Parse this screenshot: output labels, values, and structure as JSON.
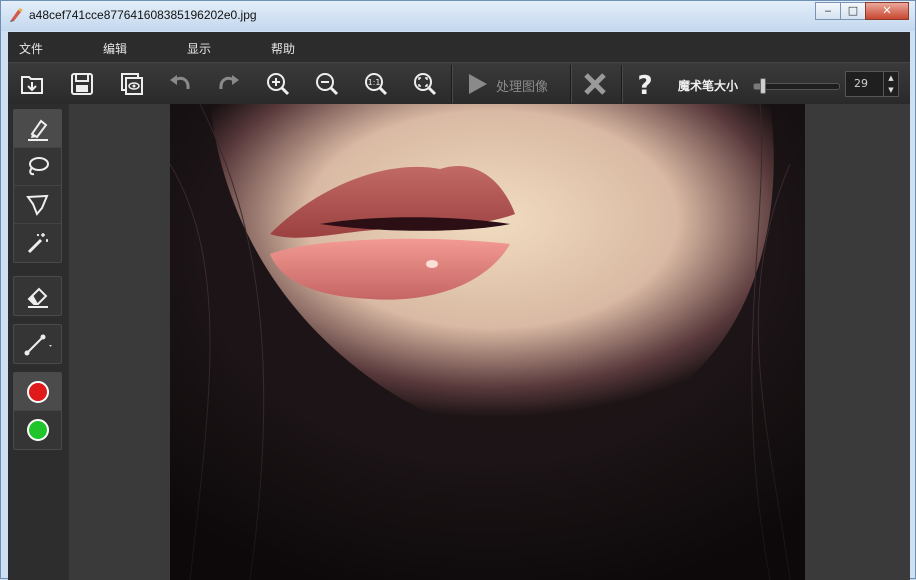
{
  "window": {
    "title": "a48cef741cce877641608385196202e0.jpg"
  },
  "window_buttons": {
    "minimize": "‒",
    "maximize": "□",
    "close": "✕"
  },
  "menu": {
    "items": [
      "文件",
      "编辑",
      "显示",
      "帮助"
    ]
  },
  "toolbar": {
    "buttons": [
      "open-icon",
      "save-icon",
      "preview-icon",
      "undo-icon",
      "redo-icon",
      "zoom-in-icon",
      "zoom-out-icon",
      "actual-size-icon",
      "fit-icon"
    ],
    "process_label": "处理图像",
    "brush_size_label": "魔术笔大小",
    "brush_size": {
      "value": "29",
      "slider_fraction": 0.1
    }
  },
  "tools": {
    "selection": [
      "marker-icon",
      "lasso-icon",
      "polygon-lasso-icon",
      "magic-wand-icon"
    ],
    "edit": [
      "eraser-icon"
    ],
    "line": [
      "line-tool-icon"
    ],
    "colors": {
      "keep": "#e0191b",
      "remove": "#1fc52a"
    }
  },
  "colors": {
    "toolbar_bg": "#2f2f2f",
    "canvas_bg": "#3a3a3a",
    "accent_red": "#e0191b",
    "accent_green": "#1fc52a"
  }
}
